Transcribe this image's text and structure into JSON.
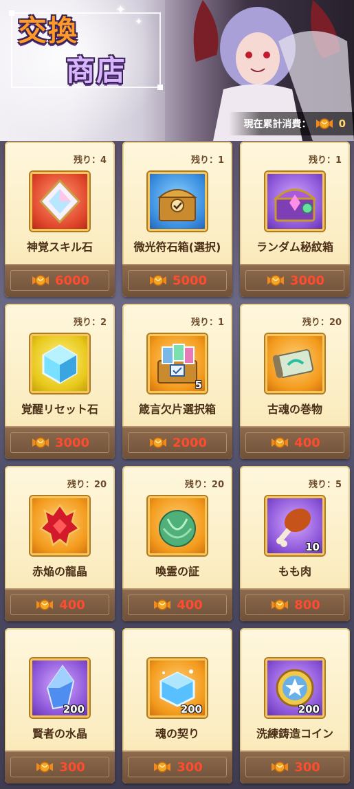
{
  "header": {
    "title_line1": "交換",
    "title_line2": "商店",
    "total_label": "現在累計消費：",
    "total_value": "0"
  },
  "colors": {
    "price": "#ff4b2e",
    "card_bg": "#fbecc0",
    "price_bar": "#7b5b40"
  },
  "items": [
    {
      "remain": "残り：4",
      "name": "神覚スキル石",
      "price": "6000",
      "icon": "red-diamond-crystal-icon",
      "theme": "red",
      "qty": ""
    },
    {
      "remain": "残り：1",
      "name": "微光符石箱(選択)",
      "price": "5000",
      "icon": "treasure-chest-icon",
      "theme": "blue",
      "qty": ""
    },
    {
      "remain": "残り：1",
      "name": "ランダム秘紋箱",
      "price": "3000",
      "icon": "purple-chest-icon",
      "theme": "purple",
      "qty": ""
    },
    {
      "remain": "残り：2",
      "name": "覚醒リセット石",
      "price": "3000",
      "icon": "blue-cube-crystal-icon",
      "theme": "yellow",
      "qty": ""
    },
    {
      "remain": "残り：1",
      "name": "箴言欠片選択箱",
      "price": "2000",
      "icon": "card-chest-icon",
      "theme": "orange",
      "qty": "5"
    },
    {
      "remain": "残り：20",
      "name": "古魂の巻物",
      "price": "400",
      "icon": "scroll-icon",
      "theme": "orange",
      "qty": ""
    },
    {
      "remain": "残り：20",
      "name": "赤焔の龍晶",
      "price": "400",
      "icon": "red-dragon-crystal-icon",
      "theme": "orange",
      "qty": ""
    },
    {
      "remain": "残り：20",
      "name": "喚霊の証",
      "price": "400",
      "icon": "green-cabbage-icon",
      "theme": "orange",
      "qty": ""
    },
    {
      "remain": "残り：5",
      "name": "もも肉",
      "price": "800",
      "icon": "drumstick-icon",
      "theme": "purple",
      "qty": "10"
    },
    {
      "remain": "",
      "name": "賢者の水晶",
      "price": "300",
      "icon": "blue-crystal-icon",
      "theme": "purple",
      "qty": "200"
    },
    {
      "remain": "",
      "name": "魂の契り",
      "price": "300",
      "icon": "ice-cube-icon",
      "theme": "orange",
      "qty": "200"
    },
    {
      "remain": "",
      "name": "洗練鋳造コイン",
      "price": "300",
      "icon": "star-coin-icon",
      "theme": "purple",
      "qty": "200"
    }
  ]
}
